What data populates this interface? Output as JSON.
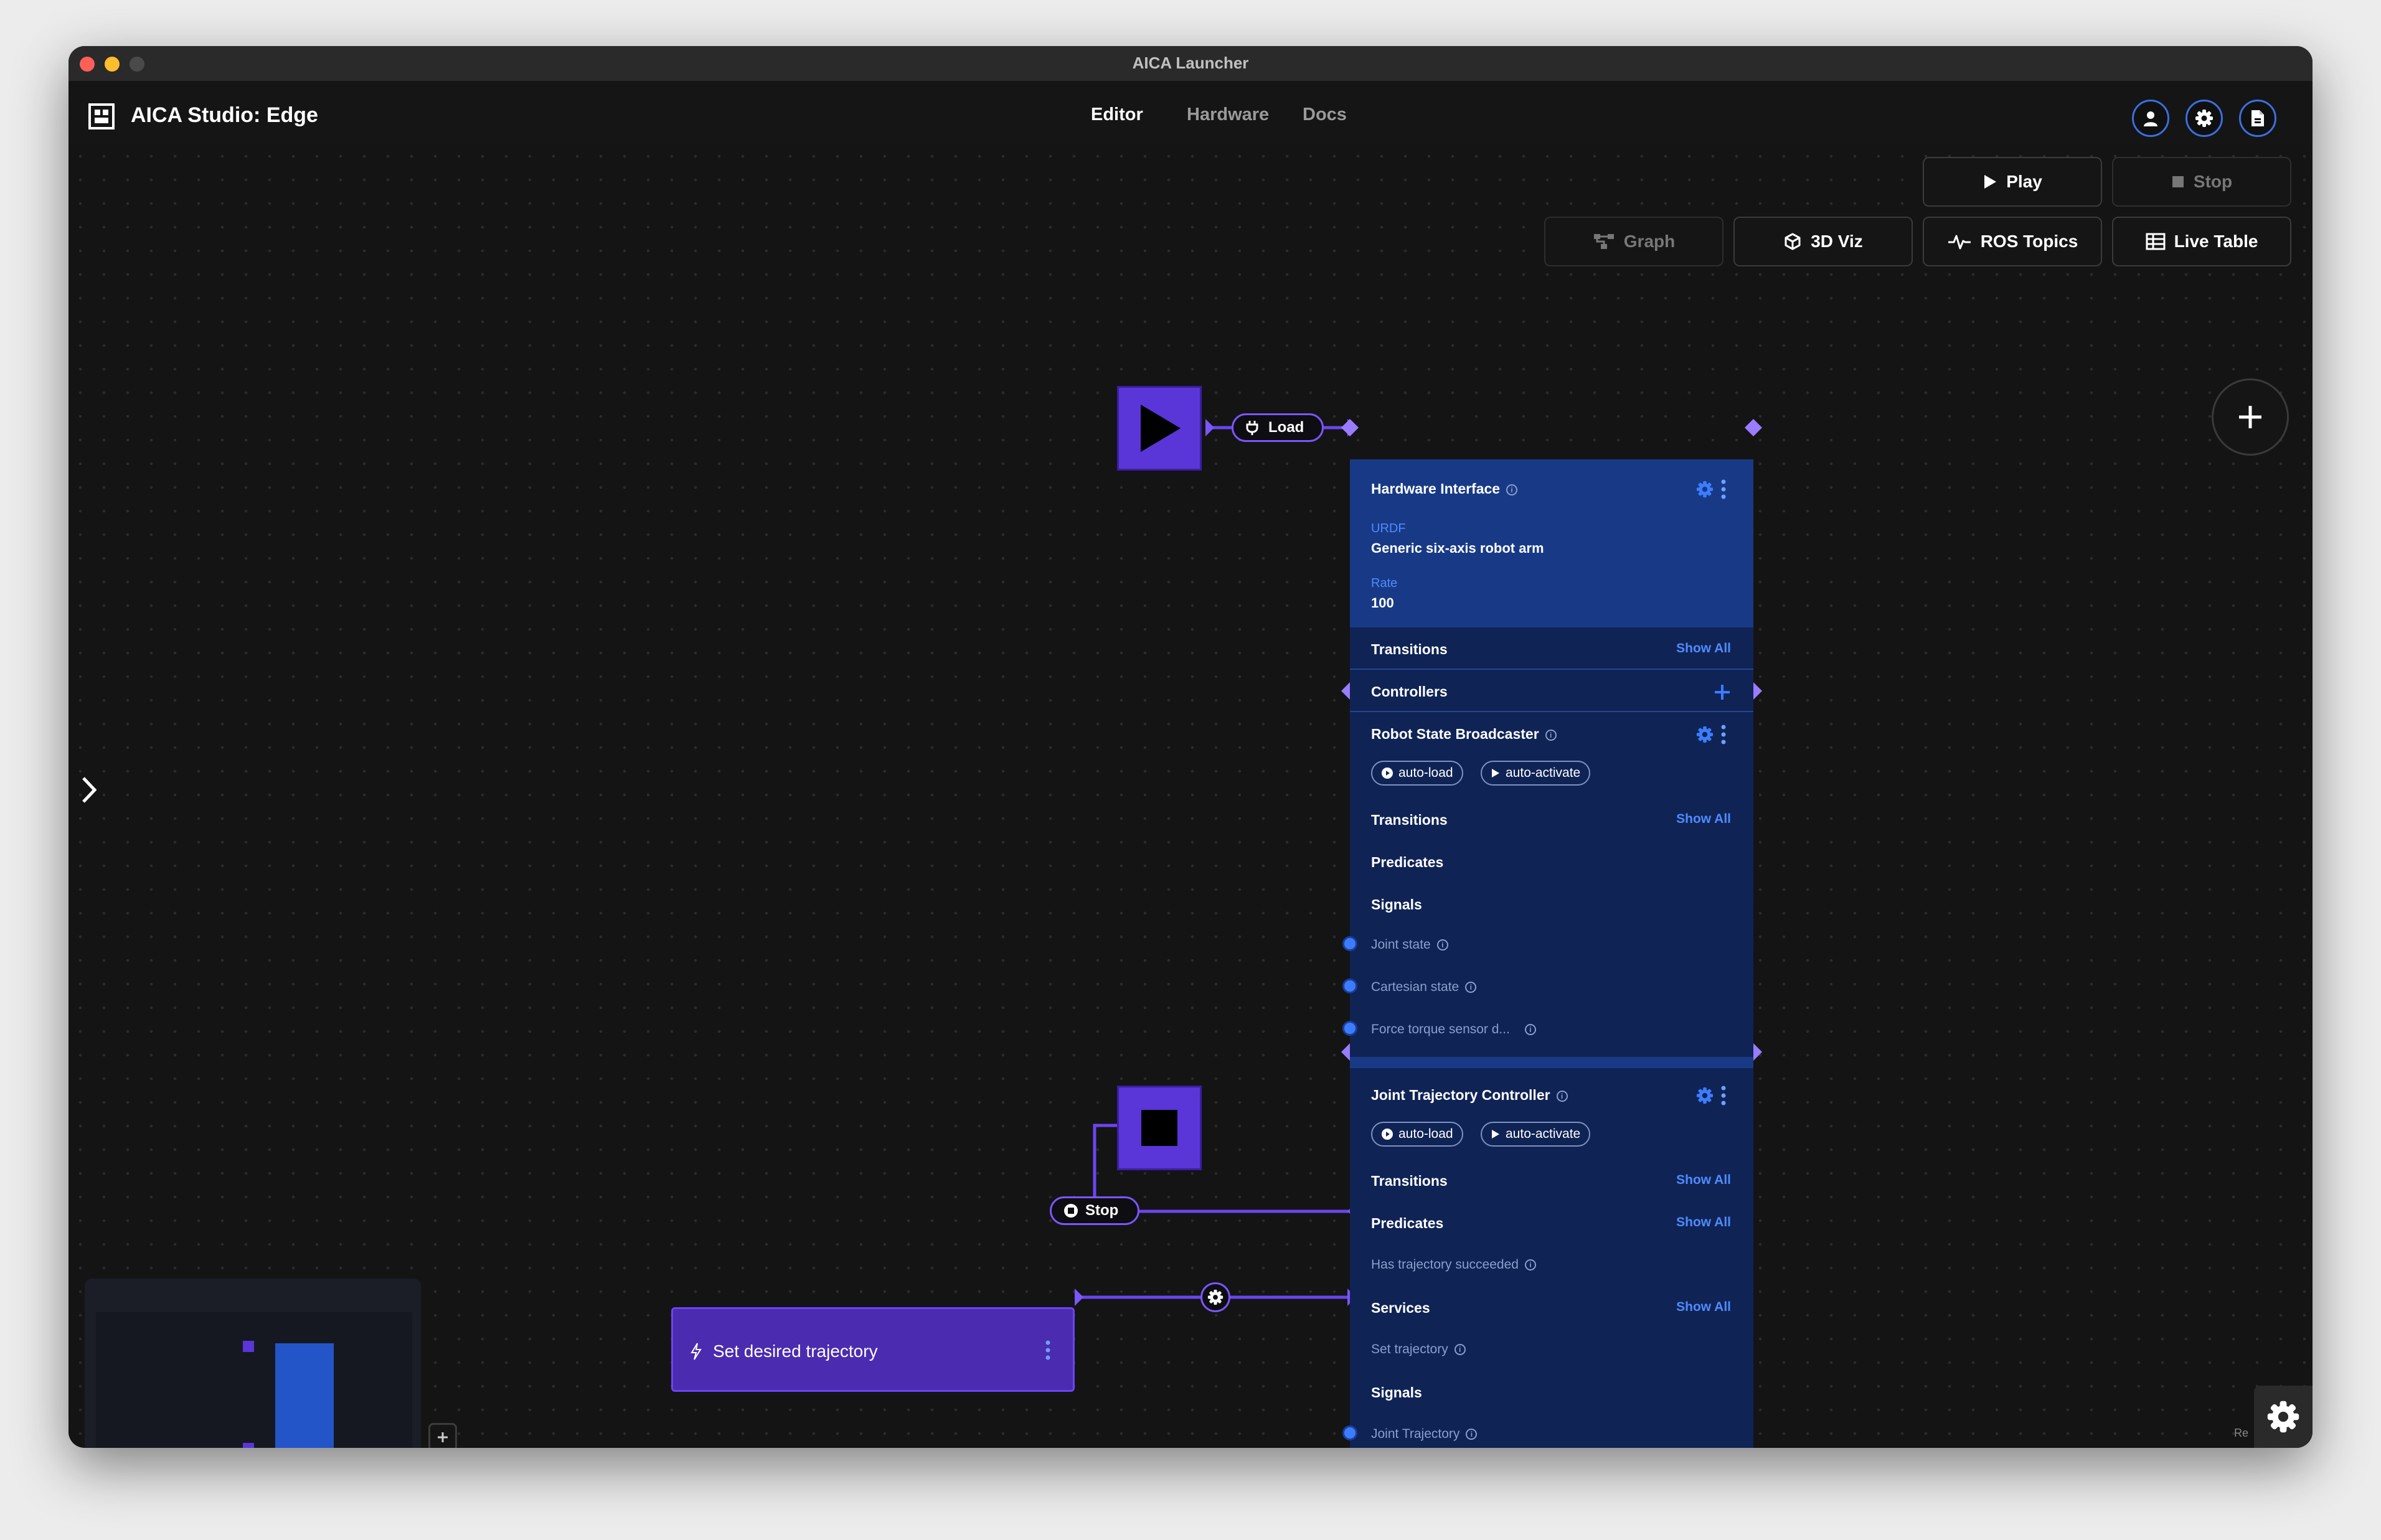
{
  "window": {
    "title": "AICA Launcher"
  },
  "header": {
    "app_title": "AICA Studio: Edge",
    "tabs": [
      "Editor",
      "Hardware",
      "Docs"
    ],
    "active_tab": "Editor",
    "icons": [
      "user-icon",
      "gear-icon",
      "file-icon"
    ]
  },
  "toolbar": {
    "play_label": "Play",
    "stop_label": "Stop",
    "graph_label": "Graph",
    "viz_label": "3D Viz",
    "ros_topics_label": "ROS Topics",
    "live_table_label": "Live Table"
  },
  "graph": {
    "load_label": "Load",
    "stop_label": "Stop",
    "hardware": {
      "title": "Hardware Interface",
      "urdf_label": "URDF",
      "urdf_value": "Generic six-axis robot arm",
      "rate_label": "Rate",
      "rate_value": "100",
      "transitions": "Transitions",
      "controllers": "Controllers",
      "show_all": "Show All"
    },
    "rsb": {
      "title": "Robot State Broadcaster",
      "tag_load": "auto-load",
      "tag_activate": "auto-activate",
      "transitions": "Transitions",
      "predicates": "Predicates",
      "signals": "Signals",
      "signal_items": [
        "Joint state",
        "Cartesian state",
        "Force torque sensor d..."
      ]
    },
    "jtc": {
      "title": "Joint Trajectory Controller",
      "tag_load": "auto-load",
      "tag_activate": "auto-activate",
      "transitions": "Transitions",
      "predicates": "Predicates",
      "predicate_item": "Has trajectory succeeded",
      "services": "Services",
      "service_item": "Set trajectory",
      "signals": "Signals",
      "signal_item": "Joint Trajectory"
    },
    "sequence": {
      "label": "Set desired trajectory"
    }
  },
  "corner": {
    "text": "Re"
  },
  "colors": {
    "accent": "#5a35d8",
    "panel": "#0f2355",
    "panel_header": "#183a86",
    "link": "#4f8bff"
  }
}
